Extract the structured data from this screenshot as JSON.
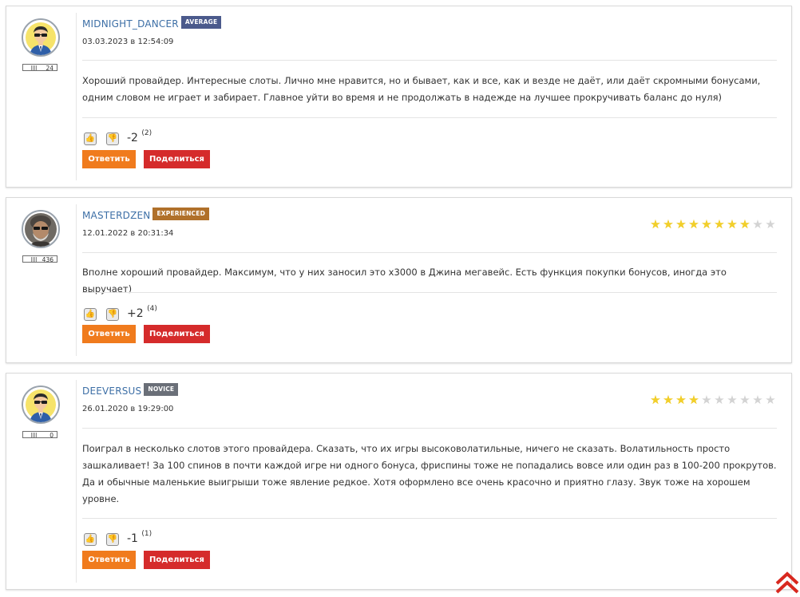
{
  "colors": {
    "username": "#3d6fa6",
    "reply_button": "#f07b1d",
    "share_button": "#d52b2b",
    "star_on": "#f2cf2a",
    "star_off": "#d3d3d3",
    "badge_average": "#4b5a8c",
    "badge_experienced": "#b0702a",
    "badge_novice": "#6a6f78"
  },
  "comments": [
    {
      "username": "MIDNIGHT_DANCER",
      "badge": "Average",
      "badge_color": "#4b5a8c",
      "reputation": "24",
      "date": "03.03.2023 в 12:54:09",
      "avatar_icon": "avatar-man-sunglasses-icon",
      "text": "Хороший провайдер. Интересные слоты. Лично мне нравится, но и бывает, как и все, как и везде не даёт, или даёт скромными бонусами, одним словом не играет и забирает. Главное уйти во время и не продолжать в надежде на лучшее прокручивать баланс до нуля)",
      "score": "-2",
      "vote_count": "(2)",
      "reply_label": "Ответить",
      "share_label": "Поделиться"
    },
    {
      "username": "MASTERDZEN",
      "badge": "Experienced",
      "badge_color": "#b0702a",
      "reputation": "436",
      "date": "12.01.2022 в 20:31:34",
      "avatar_icon": "avatar-photo-icon",
      "rating": 8,
      "rating_max": 10,
      "text": "Вполне хороший провайдер. Максимум, что у них заносил это х3000 в Джина мегавейс. Есть функция покупки бонусов, иногда это выручает)",
      "score": "+2",
      "vote_count": "(4)",
      "reply_label": "Ответить",
      "share_label": "Поделиться"
    },
    {
      "username": "DEEVERSUS",
      "badge": "Novice",
      "badge_color": "#6a6f78",
      "reputation": "0",
      "date": "26.01.2020 в 19:29:00",
      "avatar_icon": "avatar-man-sunglasses-icon",
      "rating": 4,
      "rating_max": 10,
      "text": "Поиграл в несколько слотов этого провайдера. Сказать, что их игры высоковолатильные, ничего не сказать. Волатильность просто зашкаливает! За 100 спинов в почти каждой игре ни одного бонуса, фриспины тоже не попадались вовсе или один раз в 100-200 прокрутов. Да и обычные маленькие выигрыши тоже явление редкое. Хотя оформлено все очень красочно и приятно глазу. Звук тоже на хорошем уровне.",
      "score": "-1",
      "vote_count": "(1)",
      "reply_label": "Ответить",
      "share_label": "Поделиться"
    }
  ],
  "scroll_top_icon": "double-chevron-up-icon"
}
